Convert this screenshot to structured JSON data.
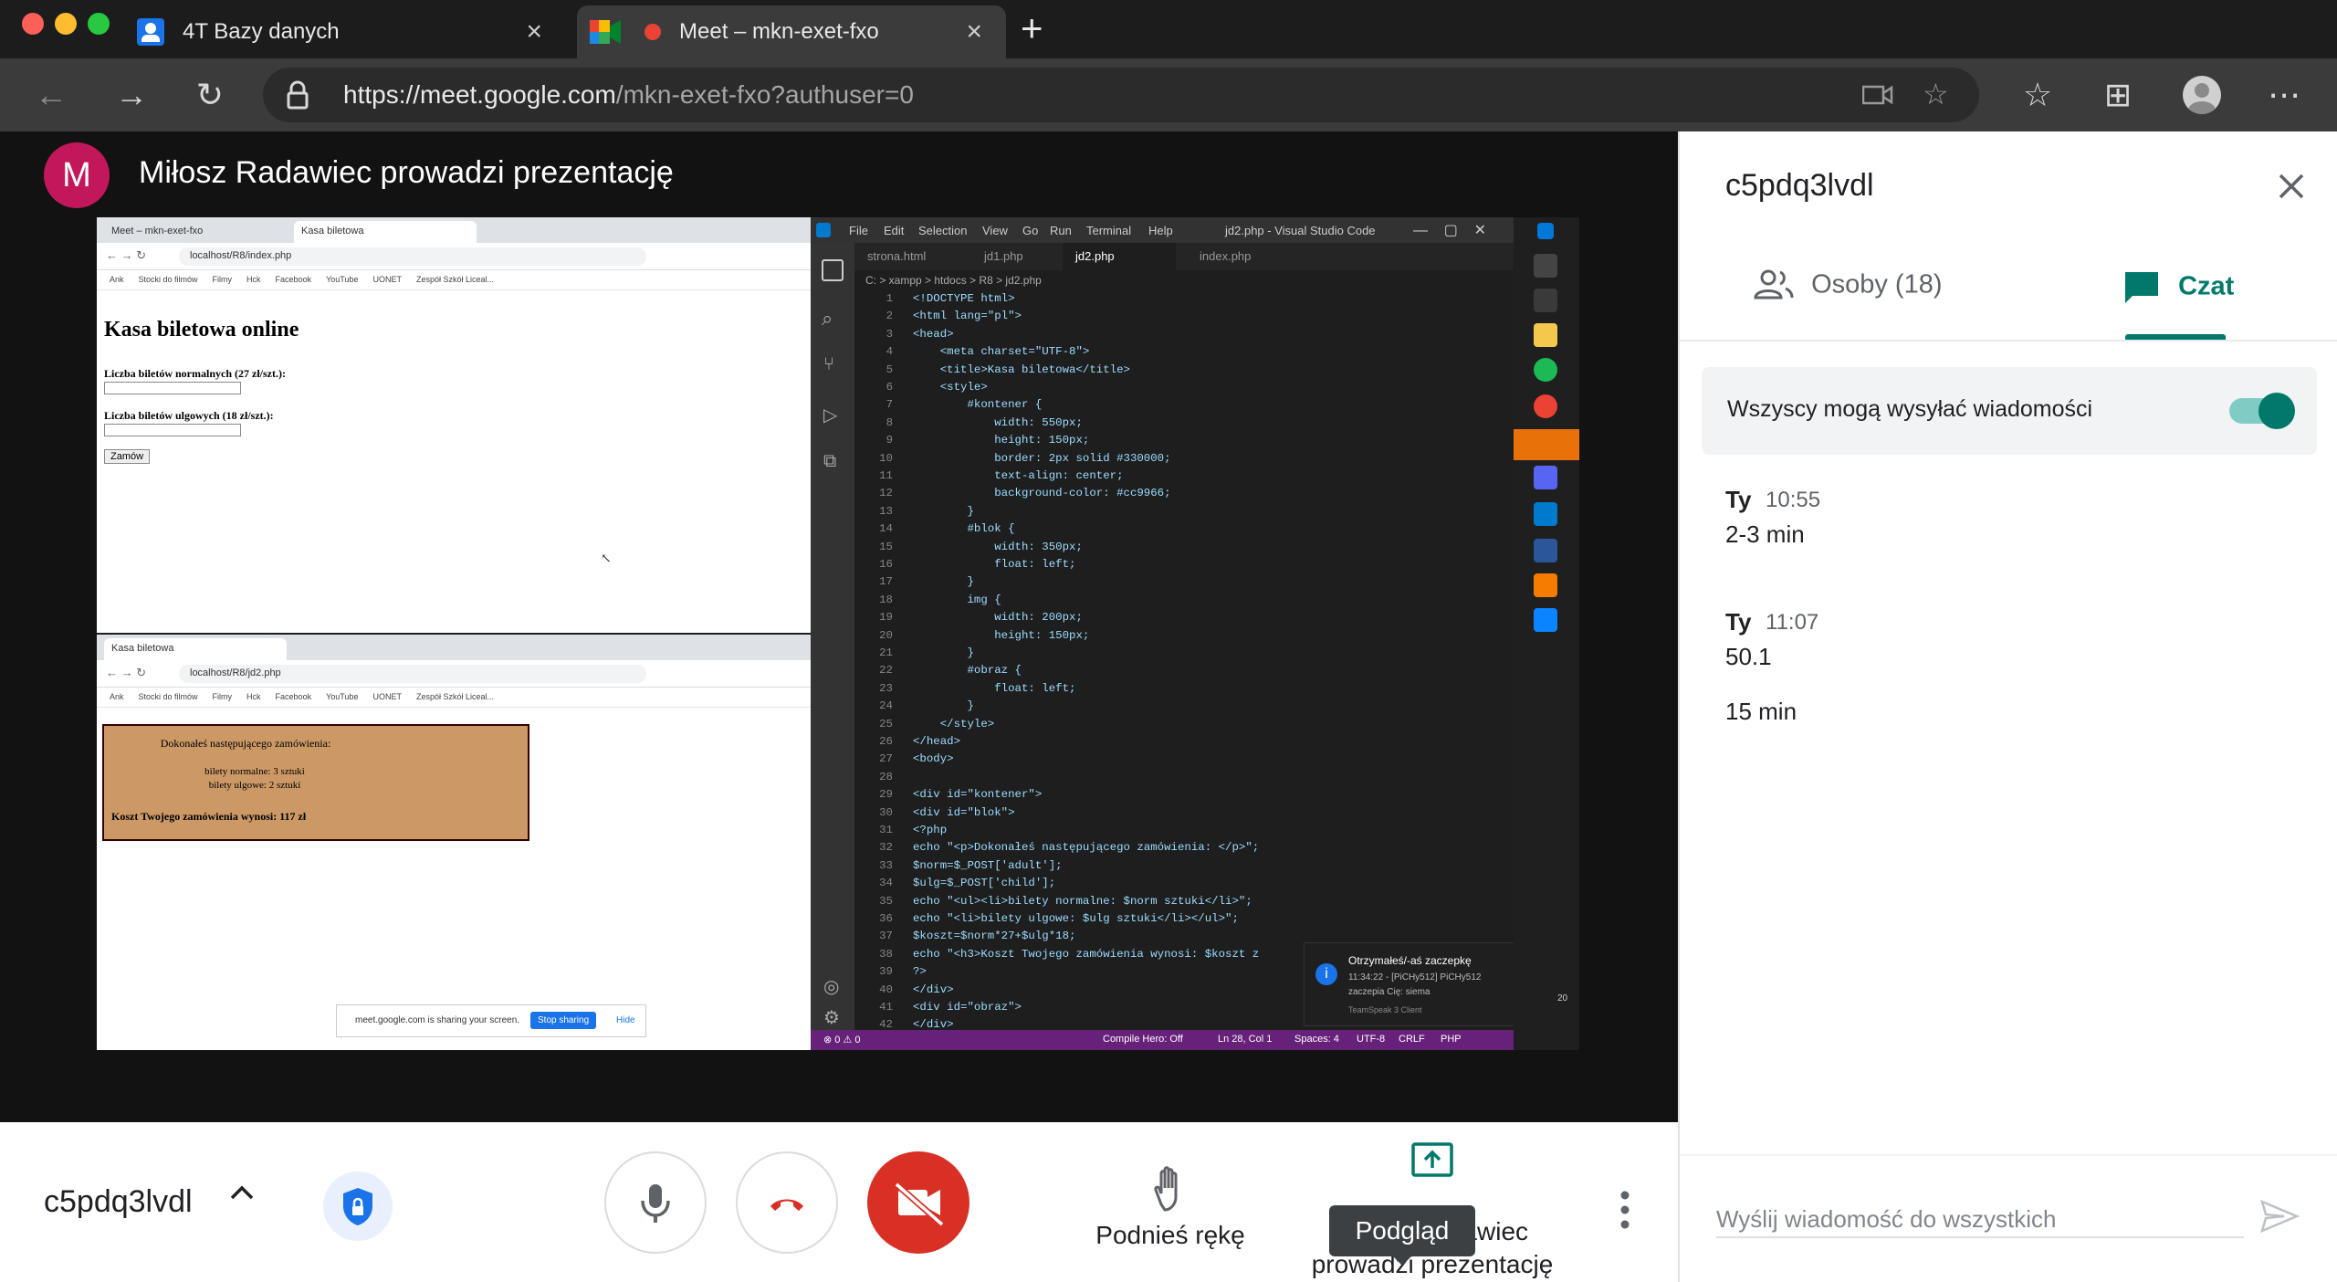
{
  "browser": {
    "tabs": [
      {
        "title": "4T Bazy danych"
      },
      {
        "title": "Meet – mkn-exet-fxo"
      }
    ],
    "url_host": "https://meet.google.com",
    "url_path": "/mkn-exet-fxo?authuser=0"
  },
  "presenter": {
    "initial": "M",
    "text": "Miłosz Radawiec prowadzi prezentację"
  },
  "shared_screen": {
    "top_browser": {
      "tabs": [
        "Meet – mkn-exet-fxo",
        "Kasa biletowa"
      ],
      "url": "localhost/R8/index.php",
      "bookmarks": [
        "Ank",
        "Stocki do filmów",
        "Filmy",
        "Hck",
        "Facebook",
        "YouTube",
        "UONET",
        "Zespół Szkół Liceal..."
      ],
      "heading": "Kasa biletowa online",
      "label1": "Liczba biletów normalnych (27 zł/szt.):",
      "label2": "Liczba biletów ulgowych (18 zł/szt.):",
      "button": "Zamów"
    },
    "bottom_browser": {
      "tab": "Kasa biletowa",
      "url": "localhost/R8/jd2.php",
      "bookmarks": [
        "Ank",
        "Stocki do filmów",
        "Filmy",
        "Hck",
        "Facebook",
        "YouTube",
        "UONET",
        "Zespół Szkół Liceal..."
      ],
      "intro": "Dokonałeś następującego zamówienia:",
      "item1": "bilety normalne: 3 sztuki",
      "item2": "bilety ulgowe: 2 sztuki",
      "total": "Koszt Twojego zamówienia wynosi: 117 zł",
      "share_text": "meet.google.com is sharing your screen.",
      "stop_sharing": "Stop sharing",
      "hide": "Hide"
    },
    "vscode": {
      "menu": [
        "File",
        "Edit",
        "Selection",
        "View",
        "Go",
        "Run",
        "Terminal",
        "Help"
      ],
      "window_title": "jd2.php - Visual Studio Code",
      "tabs": [
        "strona.html",
        "jd1.php",
        "jd2.php",
        "index.php"
      ],
      "breadcrumb": "C: > xampp > htdocs > R8 > jd2.php",
      "code": [
        "<!DOCTYPE html>",
        "<html lang=\"pl\">",
        "<head>",
        "    <meta charset=\"UTF-8\">",
        "    <title>Kasa biletowa</title>",
        "    <style>",
        "        #kontener {",
        "            width: 550px;",
        "            height: 150px;",
        "            border: 2px solid #330000;",
        "            text-align: center;",
        "            background-color: #cc9966;",
        "        }",
        "        #blok {",
        "            width: 350px;",
        "            float: left;",
        "        }",
        "        img {",
        "            width: 200px;",
        "            height: 150px;",
        "        }",
        "        #obraz {",
        "            float: left;",
        "        }",
        "    </style>",
        "</head>",
        "<body>",
        "",
        "<div id=\"kontener\">",
        "<div id=\"blok\">",
        "<?php",
        "echo \"<p>Dokonałeś następującego zamówienia: </p>\";",
        "$norm=$_POST['adult'];",
        "$ulg=$_POST['child'];",
        "echo \"<ul><li>bilety normalne: $norm sztuki</li>\";",
        "echo \"<li>bilety ulgowe: $ulg sztuki</li></ul>\";",
        "$koszt=$norm*27+$ulg*18;",
        "echo \"<h3>Koszt Twojego zamówienia wynosi: $koszt z",
        "?>",
        "</div>",
        "<div id=\"obraz\">",
        "</div>"
      ],
      "status_left": "⊗ 0 ⚠ 0",
      "status_items": [
        "Compile Hero: Off",
        "Ln 28, Col 1",
        "Spaces: 4",
        "UTF-8",
        "CRLF",
        "PHP"
      ],
      "notification": {
        "title": "Otrzymałeś/-aś zaczepkę",
        "line1": "11:34:22 - [PiCHy512] PiCHy512",
        "line2": "zaczepia Cię: siema",
        "line3": "TeamSpeak 3 Client"
      },
      "taskbar_number": "20"
    }
  },
  "controls": {
    "meeting_code": "c5pdq3lvdl",
    "raise_hand_label": "Podnieś rękę",
    "present_label": "Miłosz Radawiec prowadzi prezentację",
    "tooltip": "Podgląd"
  },
  "panel": {
    "title": "c5pdq3lvdl",
    "people_tab": "Osoby (18)",
    "chat_tab": "Czat",
    "allow_text": "Wszyscy mogą wysyłać wiadomości",
    "messages": [
      {
        "sender": "Ty",
        "time": "10:55",
        "texts": [
          "2-3 min"
        ]
      },
      {
        "sender": "Ty",
        "time": "11:07",
        "texts": [
          "50.1",
          "15 min"
        ]
      }
    ],
    "composer_placeholder": "Wyślij wiadomość do wszystkich"
  },
  "colors": {
    "meet_accent": "#00796b",
    "hangup_red": "#d93025",
    "avatar": "#c2185b",
    "vscode_status": "#68217a",
    "order_box": "#cc9966"
  }
}
